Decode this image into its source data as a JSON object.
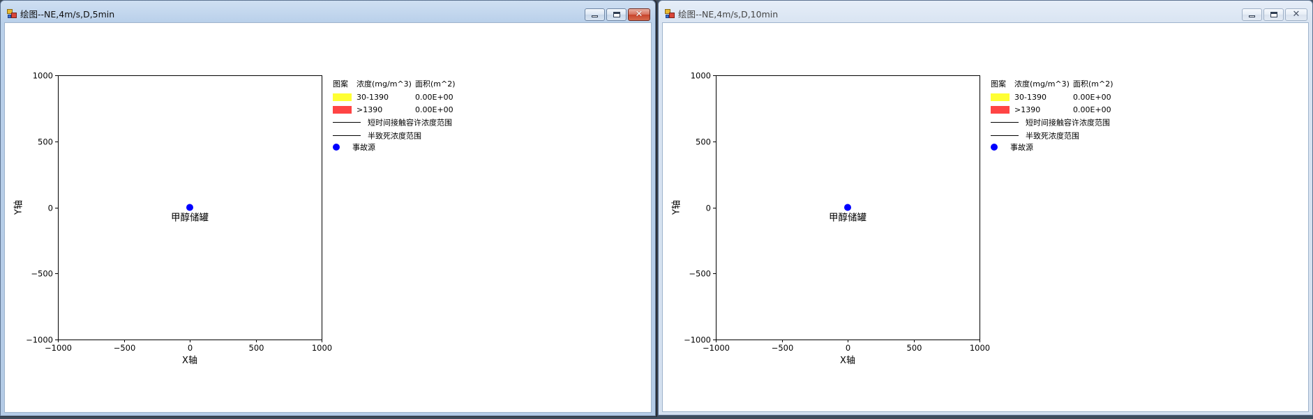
{
  "windows": [
    {
      "title": "绘图--NE,4m/s,D,5min",
      "state": "active",
      "icon": "app-icon",
      "controls": {
        "minimize": "minimize-icon",
        "maximize": "maximize-icon",
        "close": "close-icon"
      }
    },
    {
      "title": "绘图--NE,4m/s,D,10min",
      "state": "inactive",
      "icon": "app-icon",
      "controls": {
        "minimize": "minimize-icon",
        "maximize": "maximize-icon",
        "close": "close-icon"
      }
    }
  ],
  "close_glyph": "✕",
  "chart_data": [
    {
      "type": "scatter",
      "xlabel": "X轴",
      "ylabel": "Y轴",
      "xlim": [
        -1000,
        1000
      ],
      "ylim": [
        -1000,
        1000
      ],
      "xticks": [
        -1000,
        -500,
        0,
        500,
        1000
      ],
      "xtick_labels": [
        "−1000",
        "−500",
        "0",
        "500",
        "1000"
      ],
      "yticks": [
        1000,
        500,
        0,
        -500,
        -1000
      ],
      "ytick_labels": [
        "1000",
        "500",
        "0",
        "−500",
        "−1000"
      ],
      "grid": false,
      "points": [
        {
          "x": 0,
          "y": 0,
          "label": "甲醇储罐",
          "color": "#0000ff"
        }
      ],
      "legend": {
        "placement": "right",
        "headers": [
          "图案",
          "浓度(mg/m^3)",
          "面积(m^2)"
        ],
        "areas": [
          {
            "color": "#ffff33",
            "range": "30-1390",
            "area": "0.00E+00"
          },
          {
            "color": "#ff4444",
            "range": ">1390",
            "area": "0.00E+00"
          }
        ],
        "lines": [
          {
            "color": "#000000",
            "label": "短时间接触容许浓度范围"
          },
          {
            "color": "#000000",
            "label": "半致死浓度范围"
          }
        ],
        "marker": {
          "color": "#0000ff",
          "label": "事故源"
        }
      }
    },
    {
      "type": "scatter",
      "xlabel": "X轴",
      "ylabel": "Y轴",
      "xlim": [
        -1000,
        1000
      ],
      "ylim": [
        -1000,
        1000
      ],
      "xticks": [
        -1000,
        -500,
        0,
        500,
        1000
      ],
      "xtick_labels": [
        "−1000",
        "−500",
        "0",
        "500",
        "1000"
      ],
      "yticks": [
        1000,
        500,
        0,
        -500,
        -1000
      ],
      "ytick_labels": [
        "1000",
        "500",
        "0",
        "−500",
        "−1000"
      ],
      "grid": false,
      "points": [
        {
          "x": 0,
          "y": 0,
          "label": "甲醇储罐",
          "color": "#0000ff"
        }
      ],
      "legend": {
        "placement": "right",
        "headers": [
          "图案",
          "浓度(mg/m^3)",
          "面积(m^2)"
        ],
        "areas": [
          {
            "color": "#ffff33",
            "range": "30-1390",
            "area": "0.00E+00"
          },
          {
            "color": "#ff4444",
            "range": ">1390",
            "area": "0.00E+00"
          }
        ],
        "lines": [
          {
            "color": "#000000",
            "label": "短时间接触容许浓度范围"
          },
          {
            "color": "#000000",
            "label": "半致死浓度范围"
          }
        ],
        "marker": {
          "color": "#0000ff",
          "label": "事故源"
        }
      }
    }
  ]
}
